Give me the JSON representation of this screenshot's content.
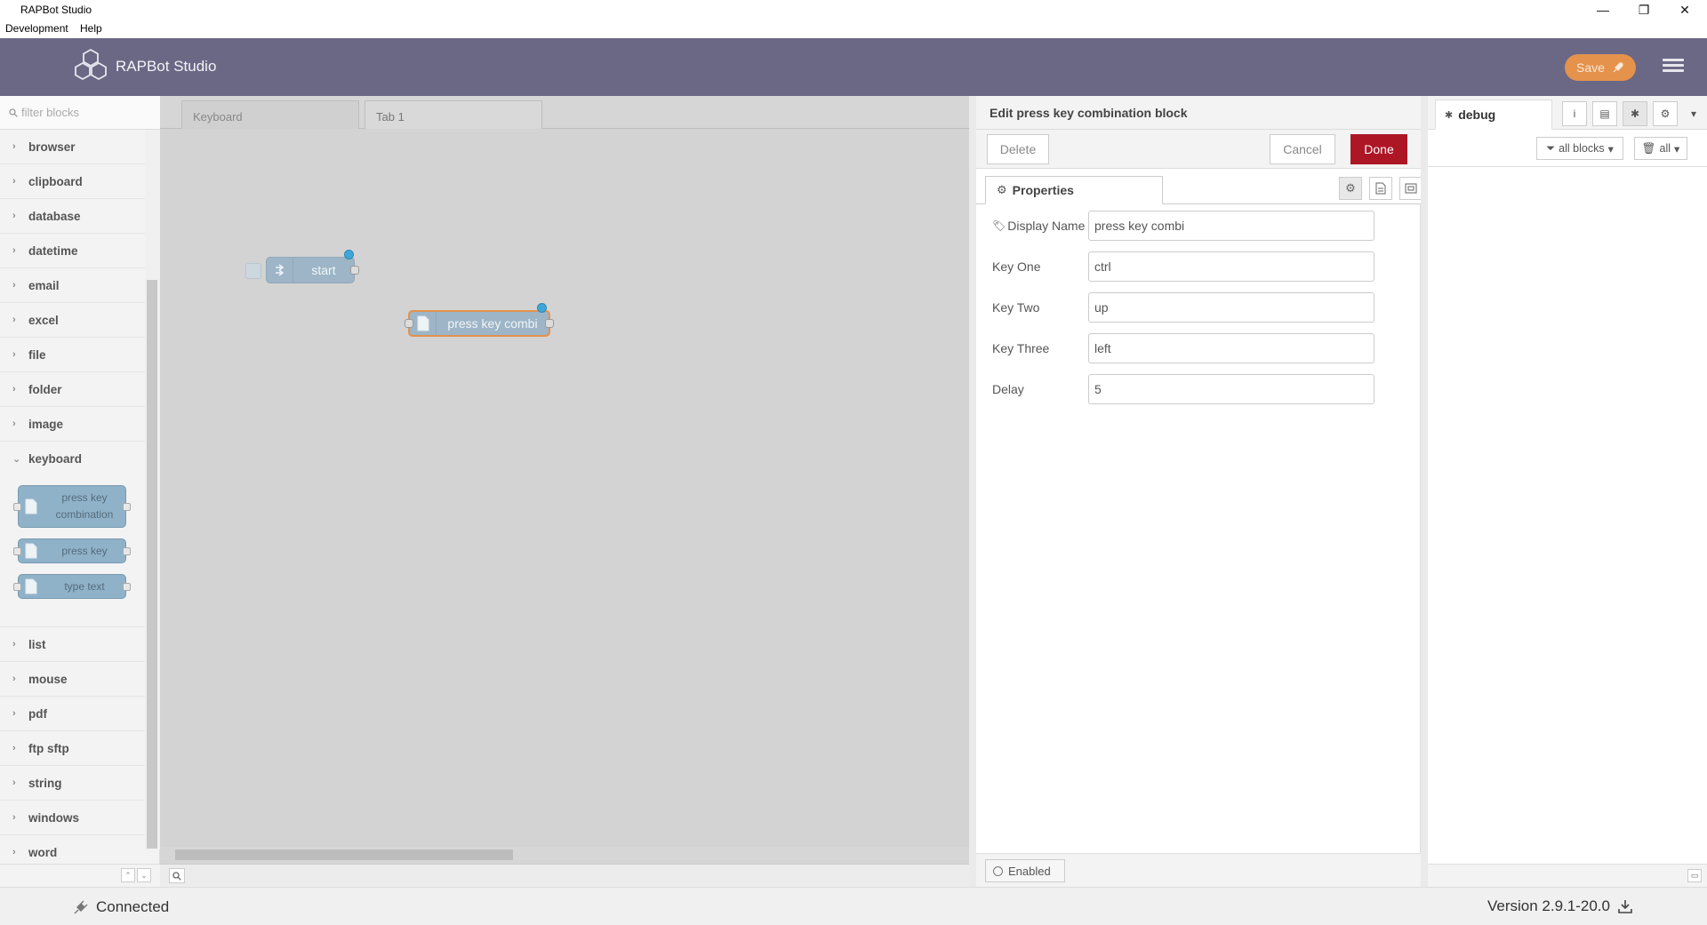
{
  "window": {
    "title": "RAPBot Studio",
    "controls": {
      "minimize": "—",
      "restore": "❐",
      "close": "✕"
    }
  },
  "menu": {
    "items": [
      "Development",
      "Help"
    ]
  },
  "header": {
    "app_title": "RAPBot Studio",
    "save_label": "Save"
  },
  "palette": {
    "filter_placeholder": "filter blocks",
    "categories_top": [
      "browser",
      "clipboard",
      "database",
      "datetime",
      "email",
      "excel",
      "file",
      "folder",
      "image"
    ],
    "open_category": "keyboard",
    "open_nodes": [
      {
        "label_line1": "press key",
        "label_line2": "combination"
      },
      {
        "label_line1": "press key",
        "label_line2": ""
      },
      {
        "label_line1": "type text",
        "label_line2": ""
      }
    ],
    "categories_bottom": [
      "list",
      "mouse",
      "pdf",
      "ftp sftp",
      "string",
      "windows",
      "word"
    ]
  },
  "workspace": {
    "tabs": [
      {
        "label": "Keyboard",
        "active": false
      },
      {
        "label": "Tab 1",
        "active": true
      }
    ],
    "nodes": {
      "start_label": "start",
      "press_label": "press key combi"
    }
  },
  "editor": {
    "title": "Edit press key combination block",
    "delete_label": "Delete",
    "cancel_label": "Cancel",
    "done_label": "Done",
    "properties_tab": "Properties",
    "fields": {
      "display_name": {
        "label": "Display Name",
        "value": "press key combi"
      },
      "key_one": {
        "label": "Key One",
        "value": "ctrl"
      },
      "key_two": {
        "label": "Key Two",
        "value": "up"
      },
      "key_three": {
        "label": "Key Three",
        "value": "left"
      },
      "delay": {
        "label": "Delay",
        "value": "5"
      }
    },
    "enabled_label": "Enabled"
  },
  "sidebar": {
    "tab_label": "debug",
    "filter_all_blocks": "all blocks",
    "filter_all": "all"
  },
  "status": {
    "connection": "Connected",
    "version": "Version 2.9.1-20.0"
  },
  "colors": {
    "header_bg": "#6b6886",
    "save_button": "#e4924c",
    "done_button": "#ad1625",
    "node_fill": "#9db5c6",
    "changed_dot": "#3fa6d9"
  }
}
